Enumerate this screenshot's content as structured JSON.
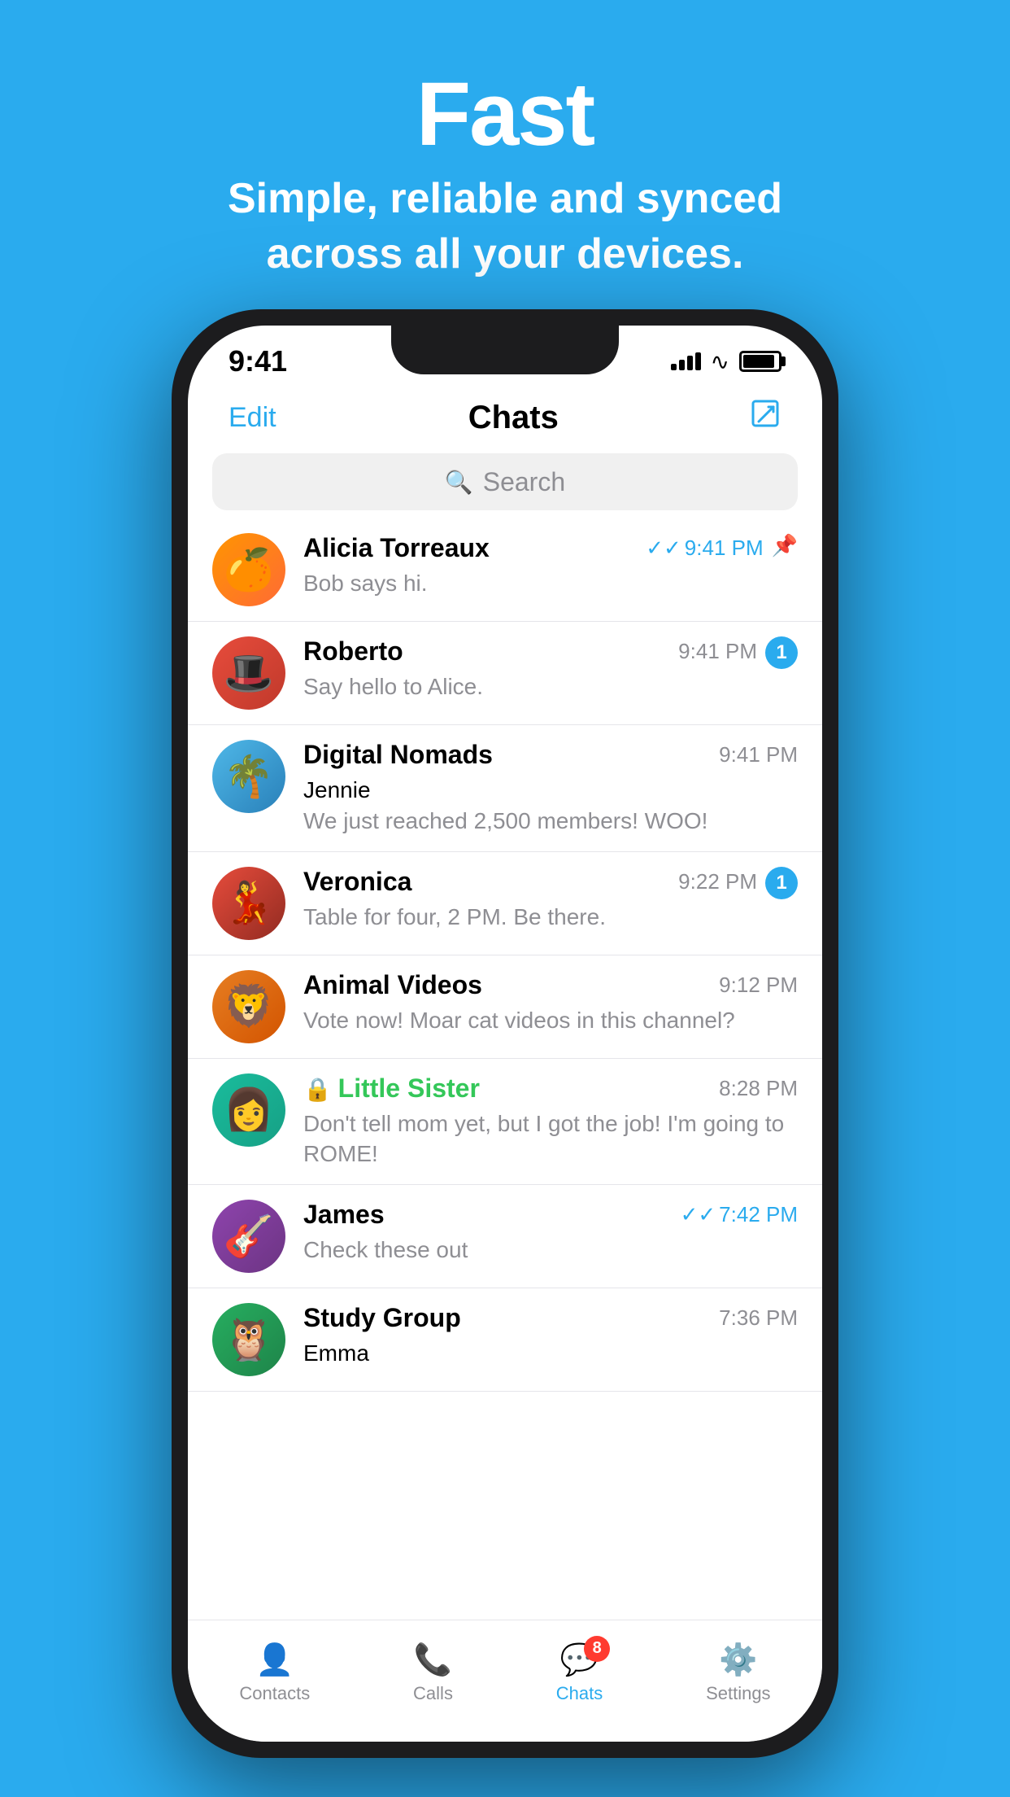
{
  "hero": {
    "title": "Fast",
    "subtitle": "Simple, reliable and synced\nacross all your devices."
  },
  "statusBar": {
    "time": "9:41",
    "signalBars": [
      8,
      13,
      18,
      22
    ],
    "batteryLevel": "90%"
  },
  "navbar": {
    "editLabel": "Edit",
    "title": "Chats",
    "composeLabel": "✏"
  },
  "search": {
    "placeholder": "Search"
  },
  "chats": [
    {
      "id": "alicia",
      "name": "Alicia Torreaux",
      "preview": "Bob says hi.",
      "time": "9:41 PM",
      "timeBlue": true,
      "hasDoubleCheck": true,
      "badge": null,
      "pinned": true,
      "senderName": null,
      "nameGreen": false,
      "avatarEmoji": "🍊"
    },
    {
      "id": "roberto",
      "name": "Roberto",
      "preview": "Say hello to Alice.",
      "time": "9:41 PM",
      "timeBlue": false,
      "hasDoubleCheck": false,
      "badge": "1",
      "pinned": false,
      "senderName": null,
      "nameGreen": false,
      "avatarEmoji": "🎩"
    },
    {
      "id": "digital",
      "name": "Digital Nomads",
      "preview": "We just reached 2,500 members! WOO!",
      "time": "9:41 PM",
      "timeBlue": false,
      "hasDoubleCheck": false,
      "badge": null,
      "pinned": false,
      "senderName": "Jennie",
      "nameGreen": false,
      "avatarEmoji": "🌴"
    },
    {
      "id": "veronica",
      "name": "Veronica",
      "preview": "Table for four, 2 PM. Be there.",
      "time": "9:22 PM",
      "timeBlue": false,
      "hasDoubleCheck": false,
      "badge": "1",
      "pinned": false,
      "senderName": null,
      "nameGreen": false,
      "avatarEmoji": "💃"
    },
    {
      "id": "animal",
      "name": "Animal Videos",
      "preview": "Vote now! Moar cat videos in this channel?",
      "time": "9:12 PM",
      "timeBlue": false,
      "hasDoubleCheck": false,
      "badge": null,
      "pinned": false,
      "senderName": null,
      "nameGreen": false,
      "avatarEmoji": "🦁"
    },
    {
      "id": "sister",
      "name": "Little Sister",
      "preview": "Don't tell mom yet, but I got the job! I'm going to ROME!",
      "time": "8:28 PM",
      "timeBlue": false,
      "hasDoubleCheck": false,
      "badge": null,
      "pinned": false,
      "senderName": null,
      "nameGreen": true,
      "avatarEmoji": "👩"
    },
    {
      "id": "james",
      "name": "James",
      "preview": "Check these out",
      "time": "7:42 PM",
      "timeBlue": true,
      "hasDoubleCheck": true,
      "badge": null,
      "pinned": false,
      "senderName": null,
      "nameGreen": false,
      "avatarEmoji": "🎸"
    },
    {
      "id": "study",
      "name": "Study Group",
      "preview": "",
      "time": "7:36 PM",
      "timeBlue": false,
      "hasDoubleCheck": false,
      "badge": null,
      "pinned": false,
      "senderName": "Emma",
      "nameGreen": false,
      "avatarEmoji": "🦉"
    }
  ],
  "tabBar": {
    "tabs": [
      {
        "id": "contacts",
        "label": "Contacts",
        "icon": "👤",
        "active": false,
        "badge": null
      },
      {
        "id": "calls",
        "label": "Calls",
        "icon": "📞",
        "active": false,
        "badge": null
      },
      {
        "id": "chats",
        "label": "Chats",
        "icon": "💬",
        "active": true,
        "badge": "8"
      },
      {
        "id": "settings",
        "label": "Settings",
        "icon": "⚙️",
        "active": false,
        "badge": null
      }
    ]
  }
}
